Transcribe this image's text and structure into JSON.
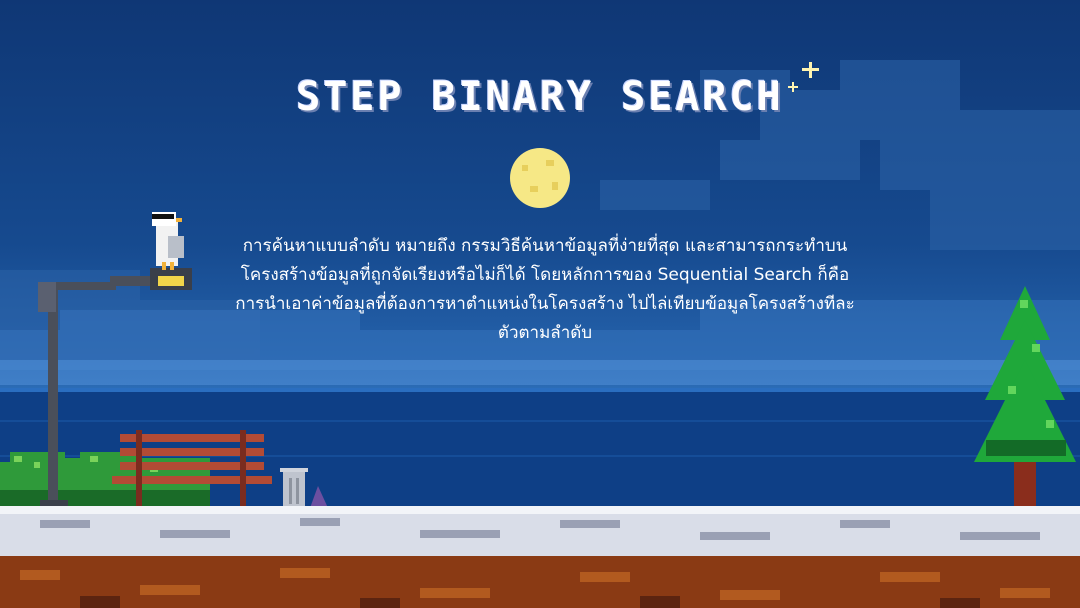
{
  "slide": {
    "title": "STEP BINARY SEARCH",
    "paragraph_lines": [
      "การค้นหาแบบลำดับ หมายถึง กรรมวิธีค้นหาข้อมูลที่ง่ายที่สุด และสามารถกระทำบน",
      "โครงสร้างข้อมูลที่ถูกจัดเรียงหรือไม่ก็ได้ โดยหลักการของ Sequential Search ก็คือ",
      "การนำเอาค่าข้อมูลที่ต้องการหาตำแหน่งในโครงสร้าง ไปไล่เทียบข้อมูลโครงสร้างทีละ",
      "ตัวตามลำดับ"
    ]
  },
  "colors": {
    "sky_top": "#0f3775",
    "sea": "#0d3c80",
    "moon": "#f4e27a",
    "snow": "#d9dde8",
    "dirt": "#8a3a14",
    "tree_green": "#1fa83a",
    "bush_green": "#2f9a3a",
    "bench_wood": "#b24b35",
    "text": "#ffffff"
  },
  "icons": {
    "moon": "moon-icon",
    "sparkle": "sparkle-icon",
    "seagull": "seagull-icon",
    "street_lamp": "street-lamp-icon",
    "bench": "bench-icon",
    "trash_can": "trash-can-icon",
    "pine_tree": "pine-tree-icon",
    "bush": "bush-icon"
  }
}
